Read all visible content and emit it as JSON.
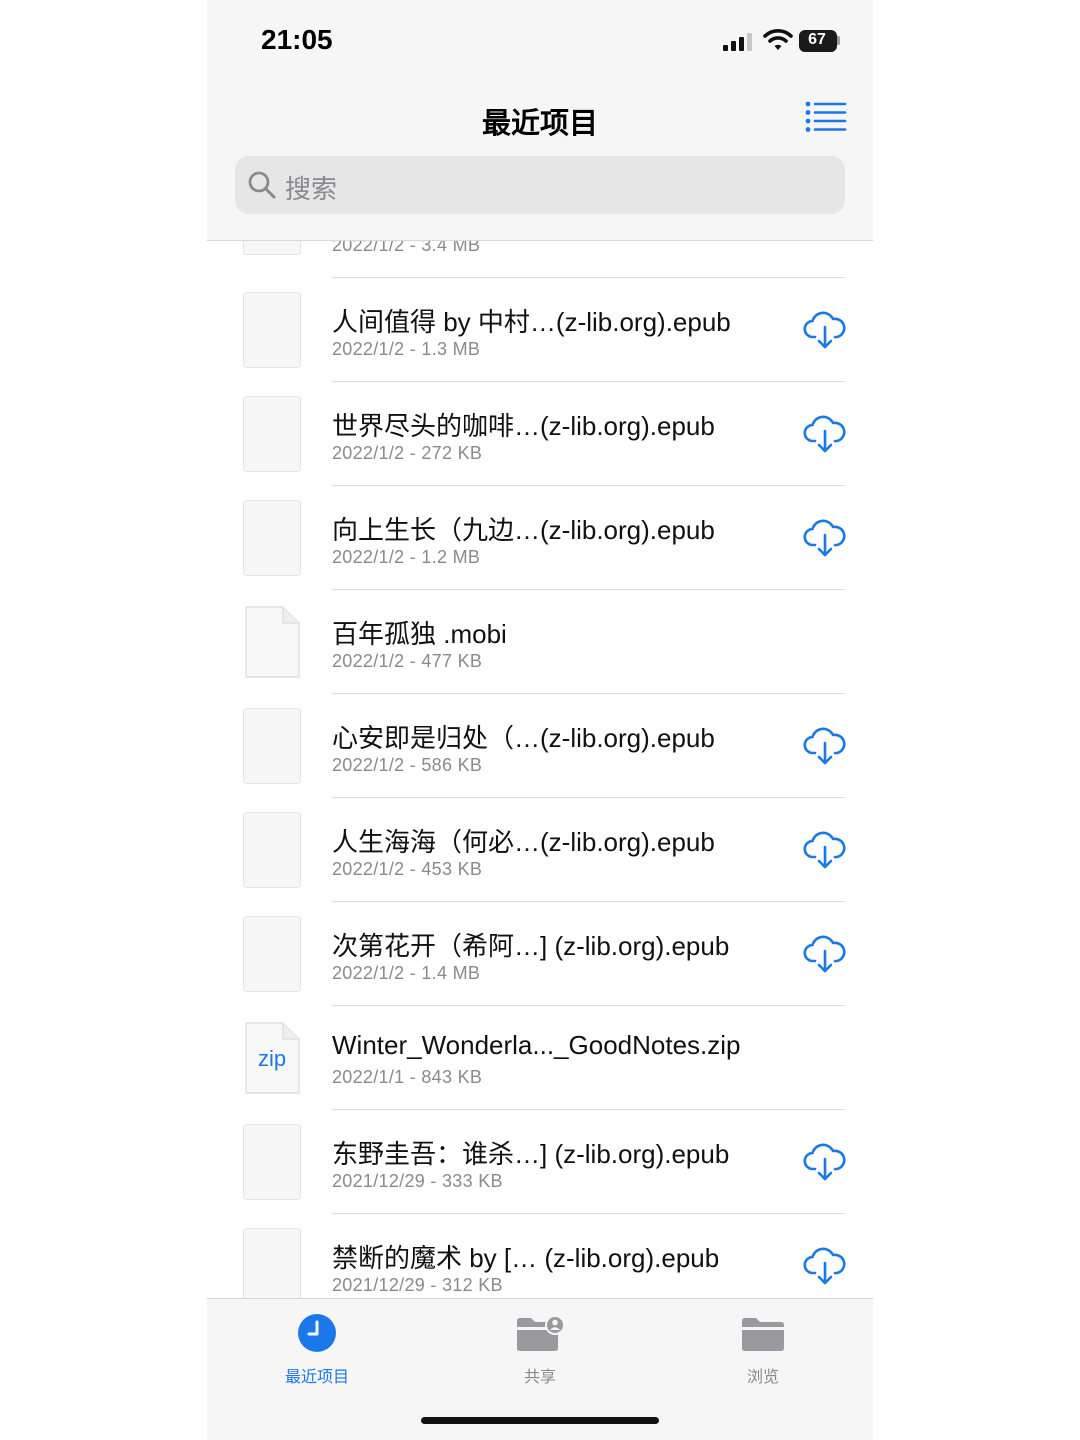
{
  "status_bar": {
    "time": "21:05",
    "battery": "67",
    "battery_level": 0.67
  },
  "header": {
    "title": "最近项目"
  },
  "search": {
    "placeholder": "搜索"
  },
  "files": [
    {
      "name": "",
      "meta": "2022/1/2 - 3.4 MB",
      "icon": "file-thumbnail",
      "cloud": false,
      "partial": true
    },
    {
      "name": "人间值得 by 中村…(z-lib.org).epub",
      "meta": "2022/1/2 - 1.3 MB",
      "icon": "file-thumbnail",
      "cloud": true
    },
    {
      "name": "世界尽头的咖啡…(z-lib.org).epub",
      "meta": "2022/1/2 - 272 KB",
      "icon": "file-thumbnail",
      "cloud": true
    },
    {
      "name": "向上生长（九边…(z-lib.org).epub",
      "meta": "2022/1/2 - 1.2 MB",
      "icon": "file-thumbnail",
      "cloud": true
    },
    {
      "name": "百年孤独 .mobi",
      "meta": "2022/1/2 - 477 KB",
      "icon": "document-icon",
      "cloud": false
    },
    {
      "name": "心安即是归处（…(z-lib.org).epub",
      "meta": "2022/1/2 - 586 KB",
      "icon": "file-thumbnail",
      "cloud": true
    },
    {
      "name": "人生海海（何必…(z-lib.org).epub",
      "meta": "2022/1/2 - 453 KB",
      "icon": "file-thumbnail",
      "cloud": true
    },
    {
      "name": "次第花开（希阿…] (z-lib.org).epub",
      "meta": "2022/1/2 - 1.4 MB",
      "icon": "file-thumbnail",
      "cloud": true
    },
    {
      "name": "Winter_Wonderla..._GoodNotes.zip",
      "meta": "2022/1/1 - 843 KB",
      "icon": "zip-document-icon",
      "icon_label": "zip",
      "cloud": false
    },
    {
      "name": "东野圭吾：谁杀…] (z-lib.org).epub",
      "meta": "2021/12/29 - 333 KB",
      "icon": "file-thumbnail",
      "cloud": true
    },
    {
      "name": "禁断的魔术 by [… (z-lib.org).epub",
      "meta": "2021/12/29 - 312 KB",
      "icon": "file-thumbnail",
      "cloud": true
    }
  ],
  "tabs": [
    {
      "label": "最近项目",
      "icon": "clock-icon",
      "active": true
    },
    {
      "label": "共享",
      "icon": "shared-folder-icon",
      "active": false
    },
    {
      "label": "浏览",
      "icon": "folder-icon",
      "active": false
    }
  ],
  "colors": {
    "accent": "#1a78e8",
    "secondary_text": "#8a8a8e",
    "bar_background": "#f6f6f6"
  }
}
